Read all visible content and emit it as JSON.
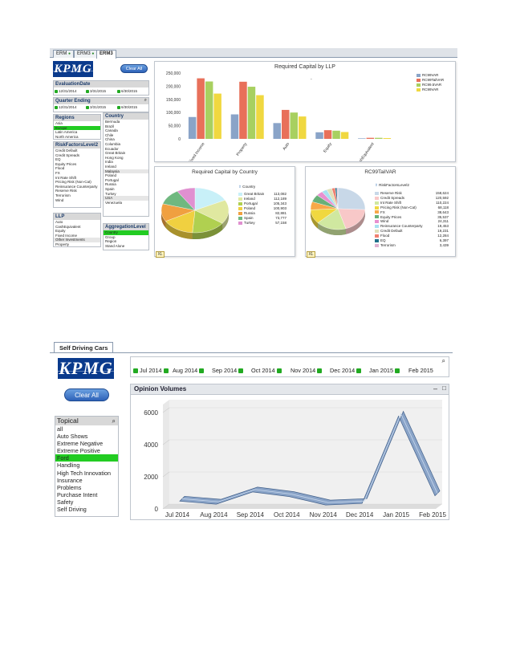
{
  "dashboard1": {
    "tabs": [
      "ERM",
      "ERM3",
      "ERM3"
    ],
    "logo": "KPMG",
    "clear_all": "Clear All",
    "evaluation_date": {
      "title": "EvaluationDate",
      "dates": [
        "12/31/2014",
        "3/31/2015",
        "6/30/2015"
      ]
    },
    "quarter_ending": {
      "title": "Quarter Ending",
      "dates": [
        "12/31/2014",
        "3/31/2015",
        "6/30/2015"
      ]
    },
    "regions": {
      "title": "Regions",
      "items": [
        "Asia",
        "Europe",
        "Latin America",
        "North America"
      ],
      "selected": "Europe"
    },
    "country": {
      "title": "Country",
      "items": [
        "Bermuda",
        "Brazil",
        "Canada",
        "Chile",
        "China",
        "Columbia",
        "Ecuador",
        "Great Britain",
        "Hong Kong",
        "India",
        "Ireland",
        "Malaysia",
        "Poland",
        "Portugal",
        "Russia",
        "Spain",
        "Turkey",
        "USA",
        "Venezuela"
      ]
    },
    "risk_factors": {
      "title": "RiskFactorsLevel2",
      "items": [
        "Credit Default",
        "Credit Spreads",
        "EQ",
        "Equity Prices",
        "Flood",
        "FX",
        "Int Rate Shift",
        "Pricing Risk (Non-Cat)",
        "Reinsurance Counterparty",
        "Reserve Risk",
        "Terrorism",
        "Wind"
      ]
    },
    "llp": {
      "title": "LLP",
      "items": [
        "Auto",
        "CashEquivalent",
        "Equity",
        "Fixed Income",
        "Other Investments",
        "Property"
      ]
    },
    "aggregation": {
      "title": "AggregationLevel",
      "items": [
        "Country",
        "Group",
        "Region",
        "Stand Alone"
      ],
      "selected": "Country"
    },
    "capital_chart": {
      "title": "Required Capital by LLP",
      "categories": [
        "Fixed Income",
        "Property",
        "Auto",
        "Equity",
        "CashEquivalent"
      ],
      "series": [
        {
          "name": "RC99VAR",
          "color": "#8aa4c8",
          "values": [
            83000,
            93000,
            60000,
            25000,
            2000
          ]
        },
        {
          "name": "RC99TailVAR",
          "color": "#e8705a",
          "values": [
            230000,
            217000,
            110000,
            33000,
            4000
          ]
        },
        {
          "name": "RC99.5VAR",
          "color": "#a8d060",
          "values": [
            218000,
            198000,
            100000,
            31000,
            4000
          ]
        },
        {
          "name": "RC99VAR",
          "color": "#f0d840",
          "values": [
            172000,
            166000,
            85000,
            26000,
            3000
          ]
        }
      ],
      "ylim": [
        0,
        250000
      ],
      "yticks": [
        "250,000",
        "200,000",
        "150,000",
        "100,000",
        "50,000",
        "0"
      ],
      "marker": "-"
    },
    "country_chart": {
      "title": "Required Capital by Country",
      "legend_title": "Country",
      "entries": [
        {
          "name": "Great Britain",
          "value": "113,082",
          "num": 113082,
          "color": "#c8f0f8"
        },
        {
          "name": "Ireland",
          "value": "112,189",
          "num": 112189,
          "color": "#e0e8a0"
        },
        {
          "name": "Portugal",
          "value": "105,343",
          "num": 105343,
          "color": "#b0d050"
        },
        {
          "name": "Poland",
          "value": "100,903",
          "num": 100903,
          "color": "#f0d040"
        },
        {
          "name": "Russia",
          "value": "82,881",
          "num": 82881,
          "color": "#f0a040"
        },
        {
          "name": "Spain",
          "value": "73,777",
          "num": 73777,
          "color": "#70b880"
        },
        {
          "name": "Turkey",
          "value": "57,158",
          "num": 57158,
          "color": "#e090d0"
        }
      ]
    },
    "tailvar_chart": {
      "title": "RC99TailVAR",
      "legend_title": "RiskFactorsLevel2",
      "entries": [
        {
          "name": "Reserve Risk",
          "value": "158,624",
          "num": 158624,
          "color": "#c8d8e8"
        },
        {
          "name": "Credit Spreads",
          "value": "120,592",
          "num": 120592,
          "color": "#f8c8c8"
        },
        {
          "name": "Int Rate Shift",
          "value": "110,224",
          "num": 110224,
          "color": "#d0e8a0"
        },
        {
          "name": "Pricing Risk (Non-Cat)",
          "value": "68,118",
          "num": 68118,
          "color": "#f0d840"
        },
        {
          "name": "FX",
          "value": "38,643",
          "num": 38643,
          "color": "#f8a848"
        },
        {
          "name": "Equity Prices",
          "value": "35,537",
          "num": 35537,
          "color": "#68b078"
        },
        {
          "name": "Wind",
          "value": "24,311",
          "num": 24311,
          "color": "#e890d0"
        },
        {
          "name": "Reinsurance Counterparty",
          "value": "19,453",
          "num": 19453,
          "color": "#a8e0f0"
        },
        {
          "name": "Credit Default",
          "value": "19,231",
          "num": 19231,
          "color": "#e0e0b8"
        },
        {
          "name": "Flood",
          "value": "12,284",
          "num": 12284,
          "color": "#f08070"
        },
        {
          "name": "EQ",
          "value": "6,397",
          "num": 6397,
          "color": "#20708a"
        },
        {
          "name": "Terrorism",
          "value": "3,439",
          "num": 3439,
          "color": "#e0b0d0"
        }
      ]
    },
    "icon_label": "XL"
  },
  "dashboard2": {
    "tab": "Self Driving Cars",
    "logo": "KPMG",
    "clear_all": "Clear All",
    "topical": {
      "title": "Topical",
      "items": [
        "all",
        "Auto Shows",
        "Extreme Negative",
        "Extreme Positive",
        "Ford",
        "Handling",
        "High Tech Innovation",
        "Insurance",
        "Problems",
        "Purchase Intent",
        "Safety",
        "Self Driving"
      ],
      "selected": "Ford"
    },
    "months": [
      "Jul 2014",
      "Aug 2014",
      "Sep 2014",
      "Oct 2014",
      "Nov 2014",
      "Dec 2014",
      "Jan 2015",
      "Feb 2015"
    ],
    "opinion_chart": {
      "title": "Opinion Volumes",
      "type": "line",
      "x": [
        "Jul 2014",
        "Aug 2014",
        "Sep 2014",
        "Oct 2014",
        "Nov 2014",
        "Dec 2014",
        "Jan 2015",
        "Feb 2015"
      ],
      "values": [
        350,
        150,
        950,
        650,
        100,
        200,
        5900,
        700
      ],
      "ylim": [
        0,
        6500
      ],
      "yticks": [
        0,
        2000,
        4000,
        6000
      ],
      "color": "#8aa4c8"
    }
  }
}
